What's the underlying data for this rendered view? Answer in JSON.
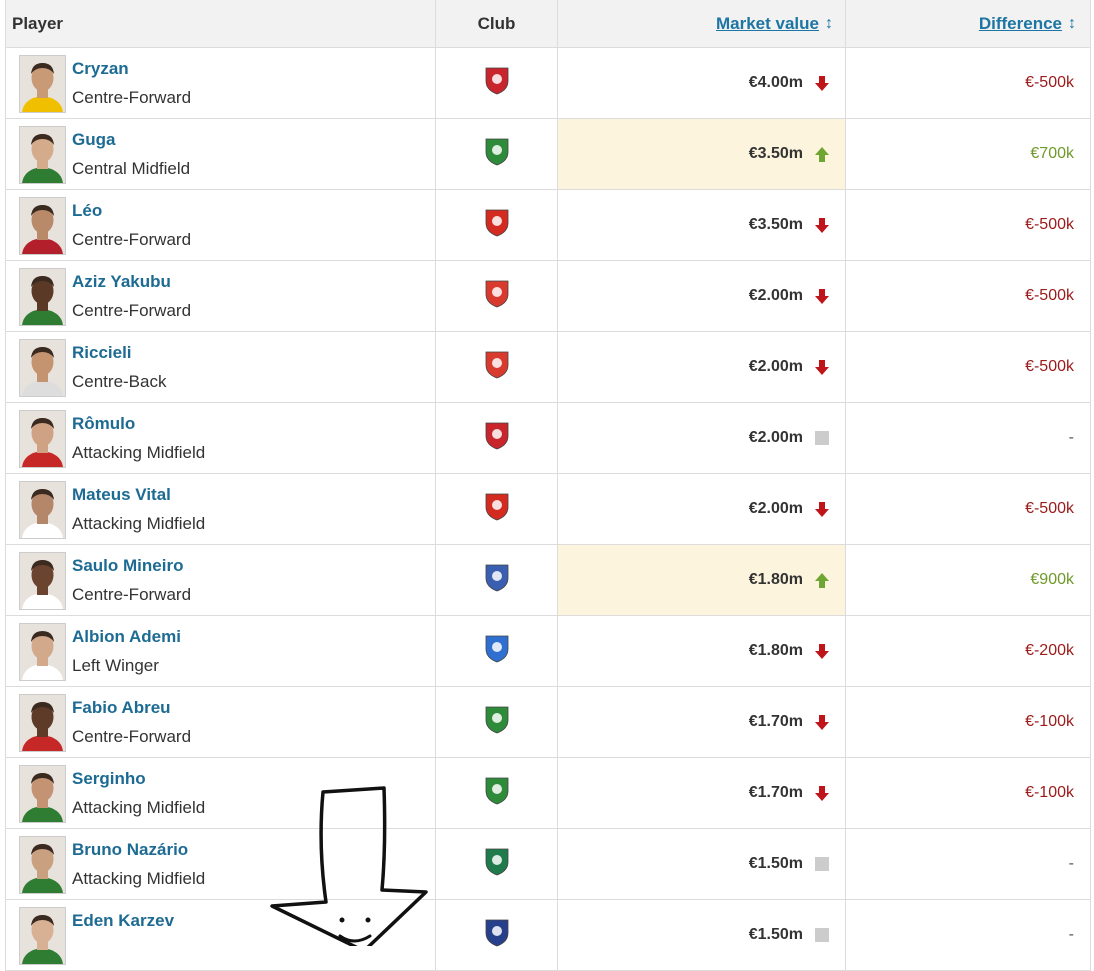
{
  "header": {
    "player": "Player",
    "club": "Club",
    "market_value": "Market value",
    "difference": "Difference"
  },
  "icons": {
    "sort": "sort-icon",
    "up": "arrow-up-icon",
    "down": "arrow-down-icon",
    "same": "unchanged-square-icon"
  },
  "colors": {
    "link": "#1d75a3",
    "negative": "#9b1a1a",
    "positive": "#6f9a2a",
    "highlight": "#fdf4dd"
  },
  "rows": [
    {
      "name": "Cryzan",
      "position": "Centre-Forward",
      "club_badge": "club-crest-red-white",
      "market_value": "€4.00m",
      "trend": "down",
      "difference": "€-500k",
      "highlight": false,
      "skin": "#c99a76",
      "shirt": "#f0c000",
      "badge": "#c8252c"
    },
    {
      "name": "Guga",
      "position": "Central Midfield",
      "club_badge": "club-crest-green",
      "market_value": "€3.50m",
      "trend": "up",
      "difference": "€700k",
      "highlight": true,
      "skin": "#d5ac8b",
      "shirt": "#2e7d32",
      "badge": "#2e8b3a"
    },
    {
      "name": "Léo",
      "position": "Centre-Forward",
      "club_badge": "club-crest-red",
      "market_value": "€3.50m",
      "trend": "down",
      "difference": "€-500k",
      "highlight": false,
      "skin": "#b88a6a",
      "shirt": "#b3202b",
      "badge": "#d42b20"
    },
    {
      "name": "Aziz Yakubu",
      "position": "Centre-Forward",
      "club_badge": "club-crest-red-yellow",
      "market_value": "€2.00m",
      "trend": "down",
      "difference": "€-500k",
      "highlight": false,
      "skin": "#5a3a26",
      "shirt": "#2e7d32",
      "badge": "#d93a2e"
    },
    {
      "name": "Riccieli",
      "position": "Centre-Back",
      "club_badge": "club-crest-red-yellow",
      "market_value": "€2.00m",
      "trend": "down",
      "difference": "€-500k",
      "highlight": false,
      "skin": "#c4936f",
      "shirt": "#dddddd",
      "badge": "#d93a2e"
    },
    {
      "name": "Rômulo",
      "position": "Attacking Midfield",
      "club_badge": "club-crest-red-stripes",
      "market_value": "€2.00m",
      "trend": "same",
      "difference": "-",
      "highlight": false,
      "skin": "#cfa283",
      "shirt": "#c62828",
      "badge": "#c8252c"
    },
    {
      "name": "Mateus Vital",
      "position": "Attacking Midfield",
      "club_badge": "club-crest-red",
      "market_value": "€2.00m",
      "trend": "down",
      "difference": "€-500k",
      "highlight": false,
      "skin": "#b4866a",
      "shirt": "#ffffff",
      "badge": "#d42b20"
    },
    {
      "name": "Saulo Mineiro",
      "position": "Centre-Forward",
      "club_badge": "club-crest-blue-red",
      "market_value": "€1.80m",
      "trend": "up",
      "difference": "€900k",
      "highlight": true,
      "skin": "#6b4430",
      "shirt": "#ffffff",
      "badge": "#3a5fb0"
    },
    {
      "name": "Albion Ademi",
      "position": "Left Winger",
      "club_badge": "club-crest-blue",
      "market_value": "€1.80m",
      "trend": "down",
      "difference": "€-200k",
      "highlight": false,
      "skin": "#d2a98b",
      "shirt": "#ffffff",
      "badge": "#2f6fd0"
    },
    {
      "name": "Fabio Abreu",
      "position": "Centre-Forward",
      "club_badge": "club-crest-green",
      "market_value": "€1.70m",
      "trend": "down",
      "difference": "€-100k",
      "highlight": false,
      "skin": "#5e3a28",
      "shirt": "#c62828",
      "badge": "#2e8b3a"
    },
    {
      "name": "Serginho",
      "position": "Attacking Midfield",
      "club_badge": "club-crest-green",
      "market_value": "€1.70m",
      "trend": "down",
      "difference": "€-100k",
      "highlight": false,
      "skin": "#c49373",
      "shirt": "#2e7d32",
      "badge": "#2e8b3a"
    },
    {
      "name": "Bruno Nazário",
      "position": "Attacking Midfield",
      "club_badge": "club-crest-green-red",
      "market_value": "€1.50m",
      "trend": "same",
      "difference": "-",
      "highlight": false,
      "skin": "#c9a080",
      "shirt": "#2e7d32",
      "badge": "#1f7a4c"
    },
    {
      "name": "Eden Karzev",
      "position": "",
      "club_badge": "club-crest-navy",
      "market_value": "€1.50m",
      "trend": "same",
      "difference": "-",
      "highlight": false,
      "skin": "#d8b094",
      "shirt": "#2e7d32",
      "badge": "#27408b"
    }
  ]
}
